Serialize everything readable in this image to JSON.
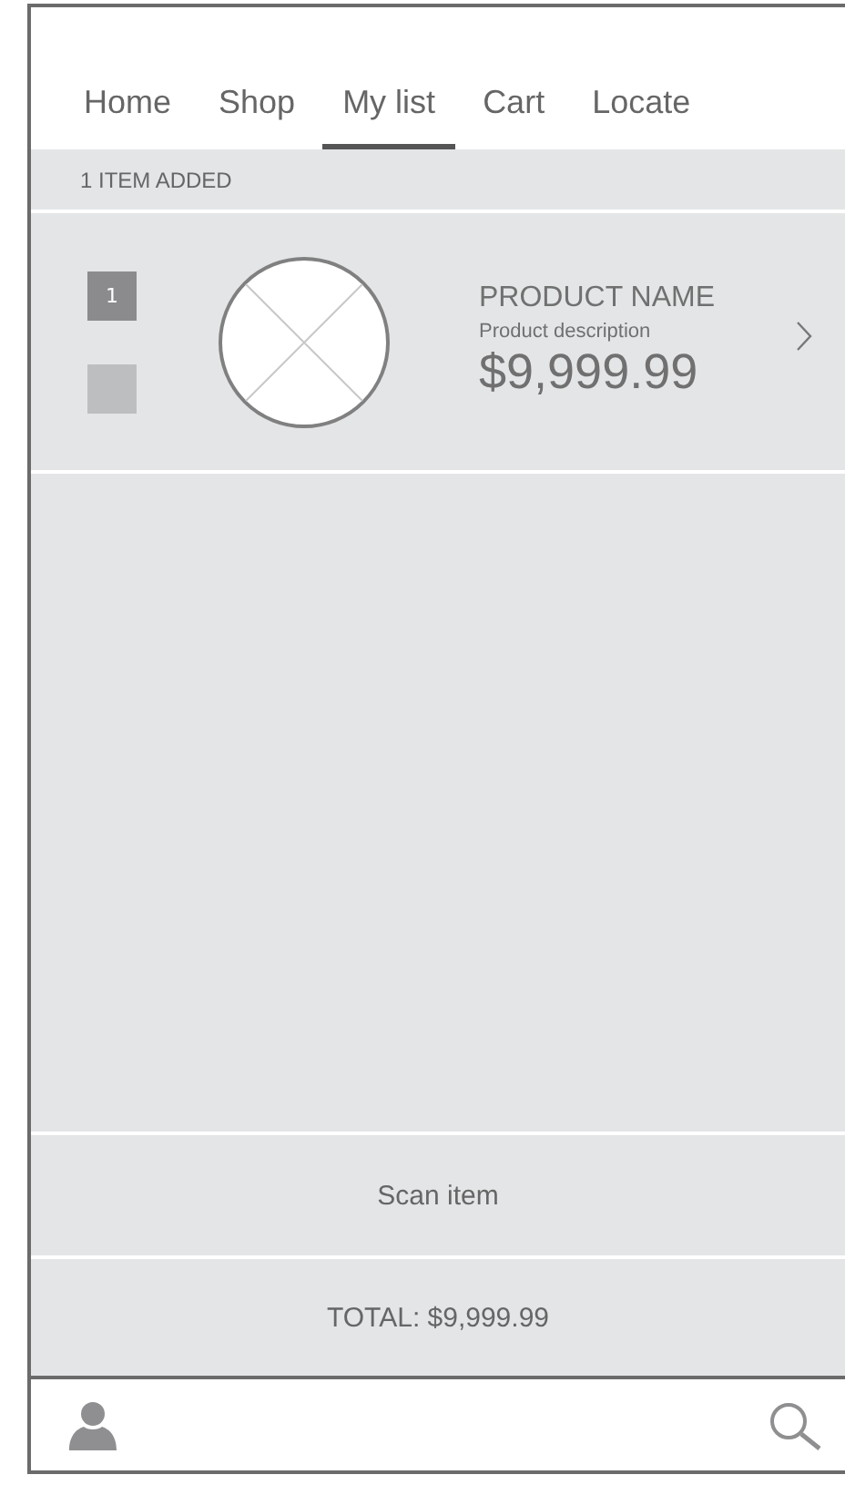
{
  "tabs": [
    {
      "label": "Home",
      "selected": false
    },
    {
      "label": "Shop",
      "selected": false
    },
    {
      "label": "My list",
      "selected": true
    },
    {
      "label": "Cart",
      "selected": false
    },
    {
      "label": "Locate",
      "selected": false
    }
  ],
  "list_header": "1 ITEM ADDED",
  "items": [
    {
      "quantity": "1",
      "checked": false,
      "name": "PRODUCT NAME",
      "description": "Product description",
      "price": "$9,999.99"
    }
  ],
  "scan_button": "Scan item",
  "total": "TOTAL: $9,999.99"
}
